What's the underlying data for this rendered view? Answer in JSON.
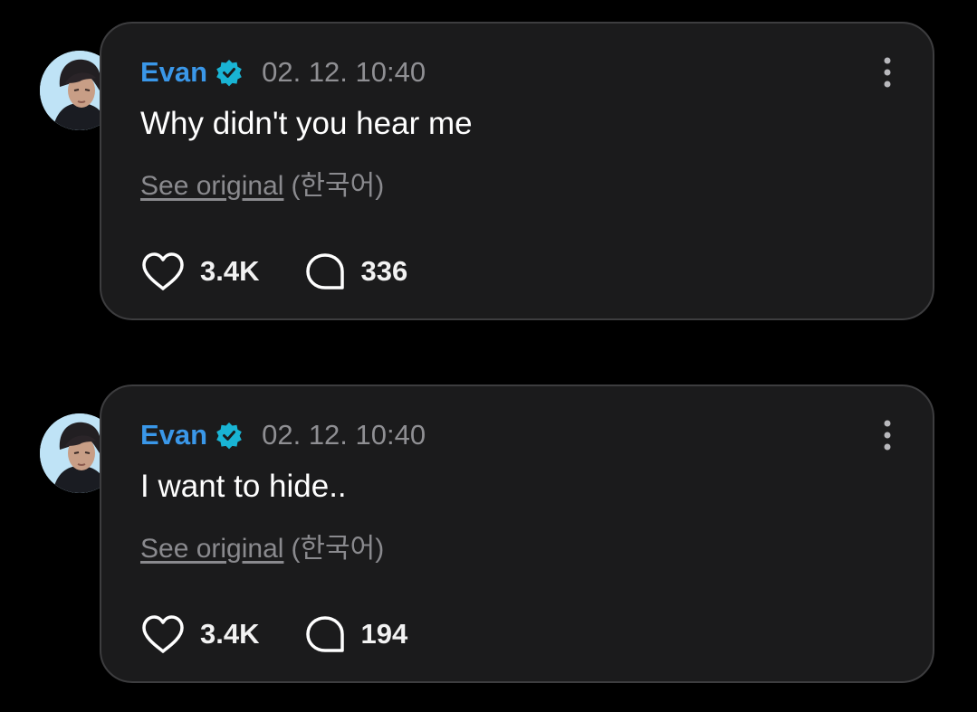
{
  "theme": {
    "background": "#000000",
    "card_background": "#1b1b1c",
    "card_border": "#3d3d3f",
    "author_color": "#3a97e8",
    "verified_badge_color": "#19b4d4",
    "muted_text": "#8f8f93"
  },
  "posts": [
    {
      "avatar_icon": "avatar-photo",
      "author": "Evan",
      "verified_icon": "verified-badge-icon",
      "timestamp": "02. 12. 10:40",
      "text": "Why didn't you hear me",
      "see_original_label": "See original",
      "original_language": "(한국어)",
      "like_icon": "heart-icon",
      "likes": "3.4K",
      "comment_icon": "comment-bubble-icon",
      "comments": "336",
      "more_icon": "more-vertical-icon"
    },
    {
      "avatar_icon": "avatar-photo",
      "author": "Evan",
      "verified_icon": "verified-badge-icon",
      "timestamp": "02. 12. 10:40",
      "text": "I want to hide..",
      "see_original_label": "See original",
      "original_language": "(한국어)",
      "like_icon": "heart-icon",
      "likes": "3.4K",
      "comment_icon": "comment-bubble-icon",
      "comments": "194",
      "more_icon": "more-vertical-icon"
    }
  ]
}
